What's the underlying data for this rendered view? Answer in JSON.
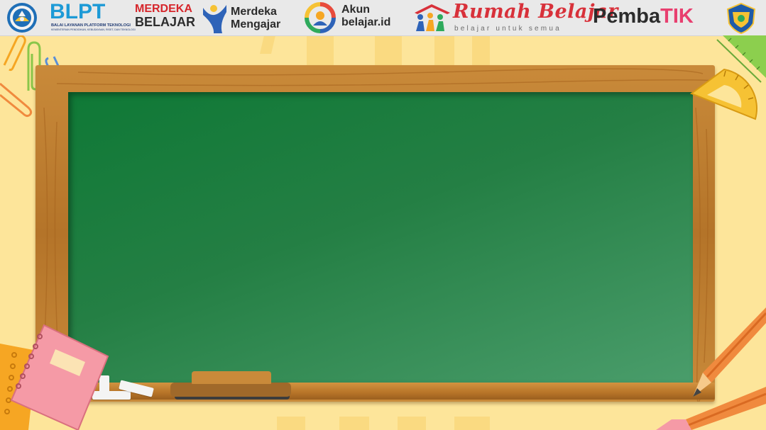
{
  "header": {
    "logos": {
      "kemendikbud_emblem": {
        "icon": "tut-wuri-handayani-emblem-icon"
      },
      "blpt": {
        "title": "BLPT",
        "subtitle": "BALAI LAYANAN PLATFORM TEKNOLOGI",
        "tagline": "KEMENTERIAN PENDIDIKAN, KEBUDAYAAN, RISET, DAN TEKNOLOGI"
      },
      "merdeka_belajar": {
        "line1": "MERDEKA",
        "line2": "BELAJAR"
      },
      "merdeka_mengajar": {
        "line1": "Merdeka",
        "line2": "Mengajar",
        "icon": "merdeka-mengajar-figure-icon"
      },
      "akun_belajar": {
        "line1": "Akun",
        "line2": "belajar.id",
        "icon": "akun-belajar-ring-icon"
      },
      "rumah_belajar": {
        "title": "Rumah Belajar",
        "subtitle": "belajar untuk semua",
        "icon": "rumah-belajar-figures-icon"
      },
      "pembatik": {
        "part1": "Pemba",
        "part2": "TIK"
      },
      "regional_emblem": {
        "icon": "regional-crest-icon"
      }
    }
  },
  "scene": {
    "chalkboard": {
      "state": "blank"
    },
    "decorations": [
      "paperclip-icon",
      "paperclip-icon",
      "paperclip-icon",
      "ruler-icon",
      "protractor-icon",
      "notebook-icon",
      "pencil-icon",
      "pencil-icon",
      "chalk-icon",
      "eraser-icon"
    ]
  },
  "colors": {
    "background": "#fde59a",
    "board_green": "#1a7a3d",
    "frame_wood": "#c2843a",
    "blpt_blue": "#1d9ad6",
    "merdeka_red": "#d6262b",
    "rumah_red": "#d8313a",
    "pembatik_pink": "#e83f6f"
  }
}
